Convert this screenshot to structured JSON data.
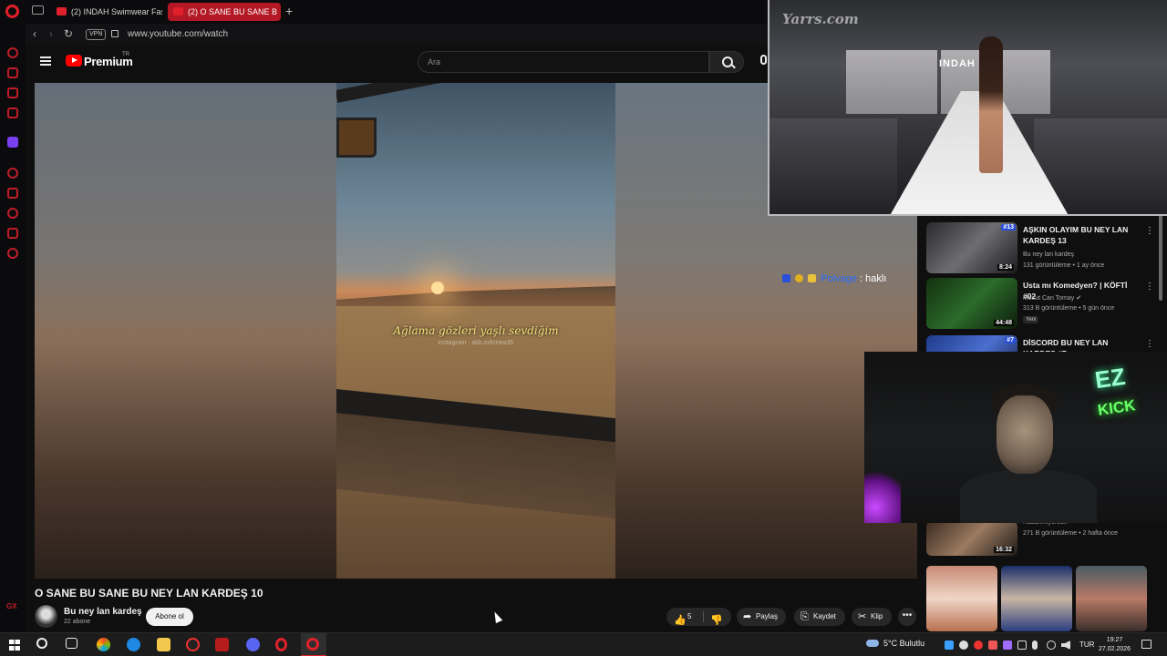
{
  "browser": {
    "tabs": [
      {
        "label": "(2) INDAH Swimwear Fash",
        "active": false
      },
      {
        "label": "(2) O SANE BU SANE B",
        "active": true
      }
    ],
    "new_tab": "+",
    "vpn_label": "VPN",
    "url": "www.youtube.com/watch"
  },
  "youtube": {
    "brand": "Premium",
    "region": "TR",
    "search_placeholder": "Ara"
  },
  "video": {
    "lyrics": "Ağlama gözleri yaşlı sevdiğim",
    "lyric_credit": "instagram : akb.ozkrnea35",
    "title": "O SANE BU SANE BU NEY LAN KARDEŞ 10",
    "channel": "Bu ney lan kardeş",
    "subscribers": "22 abone",
    "subscribe_label": "Abone ol",
    "likes": "5",
    "share_label": "Paylaş",
    "save_label": "Kaydet",
    "clip_label": "Klip",
    "more_label": "•••"
  },
  "chat": {
    "user": "Polvage",
    "message": ": haklı",
    "user_color": "#2a6cff"
  },
  "recommendations": [
    {
      "title": "AŞKIN OLAYIM BU NEY LAN KARDEŞ 13",
      "channel": "Bu ney lan kardeş",
      "meta": "131 görüntüleme • 1 ay önce",
      "duration": "8:24",
      "tag": "#13",
      "new": ""
    },
    {
      "title": "Usta mı Komedyen? | KÖFTİ #02",
      "channel": "Mesut Can Tomay ✔",
      "meta": "313 B görüntüleme • 5 gün önce",
      "duration": "44:48",
      "tag": "",
      "new": "Yeni"
    },
    {
      "title": "DİSCORD BU NEY LAN KARDEŞ #7",
      "channel": "",
      "meta": "",
      "duration": "",
      "tag": "#7",
      "new": ""
    },
    {
      "title": "",
      "channel": "Hasanmiyorsun",
      "meta": "271 B görüntüleme • 2 hafta önce",
      "duration": "16:32",
      "tag": "",
      "new": ""
    }
  ],
  "overlays": {
    "watermark": "Yarrs.com",
    "runway_sign": "INDAH",
    "ez_text": "EZ",
    "kick_text": "KICK"
  },
  "taskbar": {
    "weather": "5°C  Bulutlu",
    "language": "TUR",
    "time": "19:27",
    "date": "27.02.2026"
  },
  "sidebar": {
    "gx_label": "GX"
  }
}
